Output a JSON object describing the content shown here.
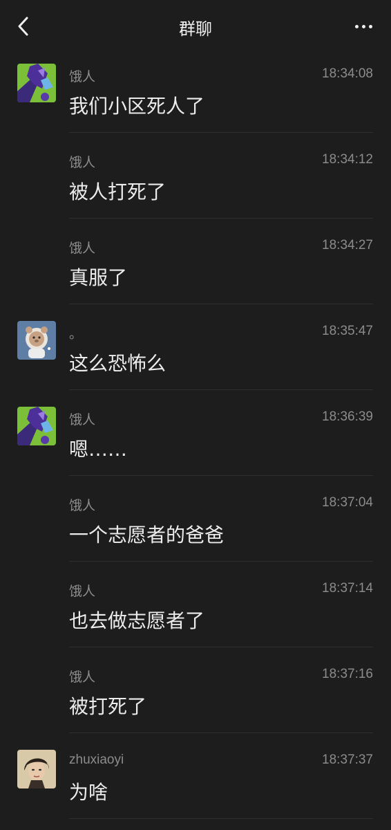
{
  "header": {
    "title": "群聊"
  },
  "messages": [
    {
      "sender": "饿人",
      "time": "18:34:08",
      "text": "我们小区死人了",
      "avatar": "purple-green"
    },
    {
      "sender": "饿人",
      "time": "18:34:12",
      "text": "被人打死了",
      "avatar": ""
    },
    {
      "sender": "饿人",
      "time": "18:34:27",
      "text": "真服了",
      "avatar": ""
    },
    {
      "sender": "。",
      "time": "18:35:47",
      "text": "这么恐怖么",
      "avatar": "bear-astronaut"
    },
    {
      "sender": "饿人",
      "time": "18:36:39",
      "text": "嗯……",
      "avatar": "purple-green"
    },
    {
      "sender": "饿人",
      "time": "18:37:04",
      "text": "一个志愿者的爸爸",
      "avatar": ""
    },
    {
      "sender": "饿人",
      "time": "18:37:14",
      "text": "也去做志愿者了",
      "avatar": ""
    },
    {
      "sender": "饿人",
      "time": "18:37:16",
      "text": "被打死了",
      "avatar": ""
    },
    {
      "sender": "zhuxiaoyi",
      "time": "18:37:37",
      "text": "为啥",
      "avatar": "portrait-woman"
    }
  ]
}
